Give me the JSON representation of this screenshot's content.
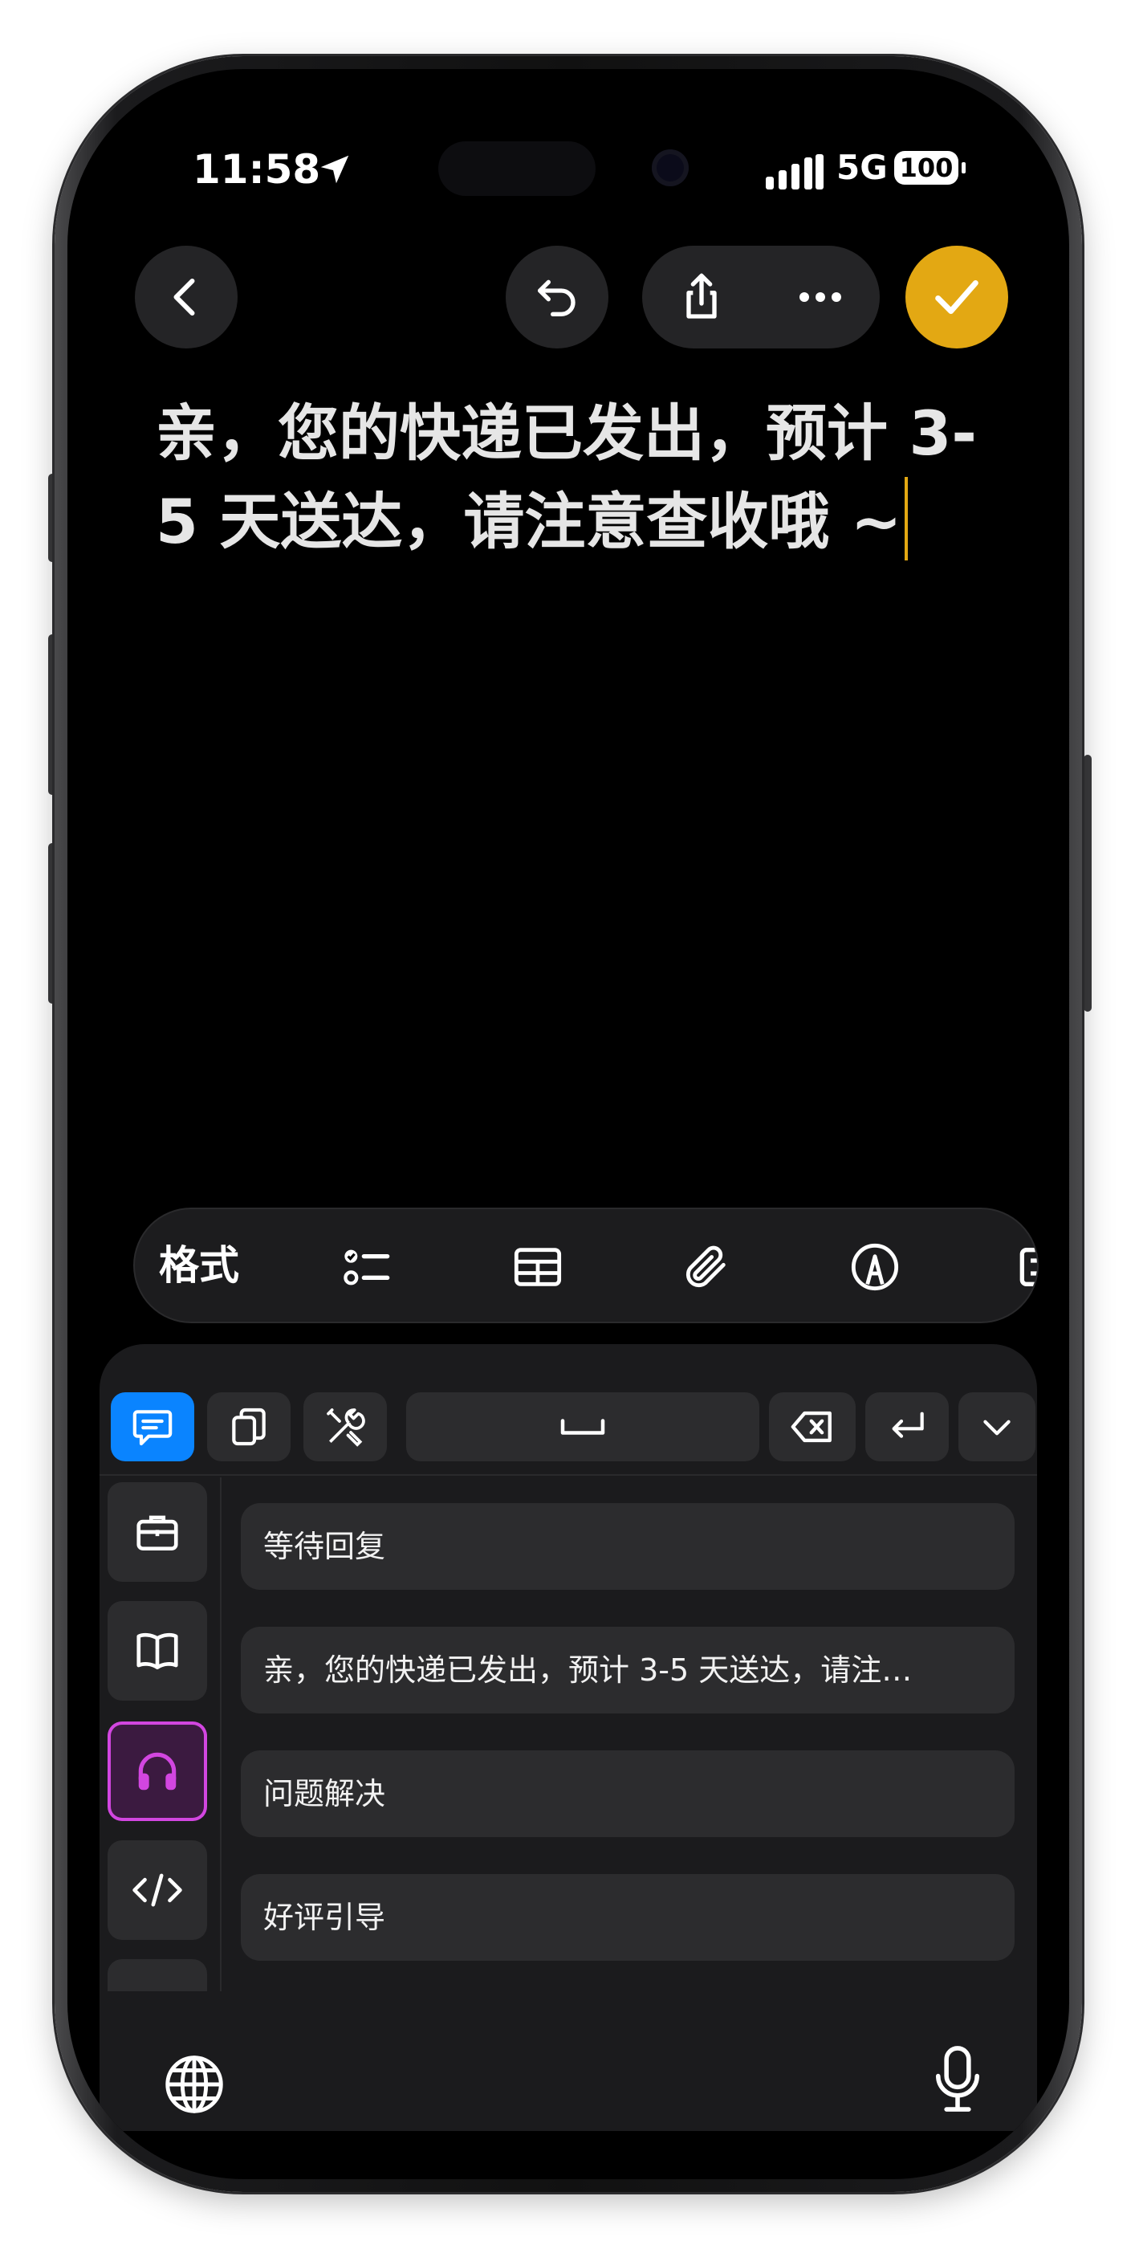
{
  "status_bar": {
    "time": "11:58",
    "network": "5G",
    "battery": "100"
  },
  "nav": {
    "back_icon": "chevron-left-icon",
    "undo_icon": "undo-icon",
    "share_icon": "share-icon",
    "more_icon": "ellipsis-icon",
    "done_icon": "checkmark-icon",
    "done_color": "#e3a813"
  },
  "editor": {
    "text": "亲，您的快递已发出，预计 3-5 天送达，请注意查收哦 ~"
  },
  "format_toolbar": {
    "format_label": "格式",
    "icons": [
      "checklist-icon",
      "table-icon",
      "paperclip-icon",
      "markup-pen-icon",
      "more-tools-icon"
    ]
  },
  "keyboard": {
    "top_buttons": [
      "message-icon",
      "clipboard-icon",
      "tools-icon",
      "space-key",
      "delete-key",
      "return-key",
      "dismiss-keyboard-icon"
    ],
    "categories": [
      "briefcase-icon",
      "book-icon",
      "headphones-icon",
      "code-icon"
    ],
    "selected_category": "headphones-icon",
    "phrases": [
      "等待回复",
      "亲，您的快递已发出，预计 3-5 天送达，请注…",
      "问题解决",
      "好评引导"
    ],
    "accent_color": "#0a84ff",
    "selected_color": "#d246e0"
  }
}
